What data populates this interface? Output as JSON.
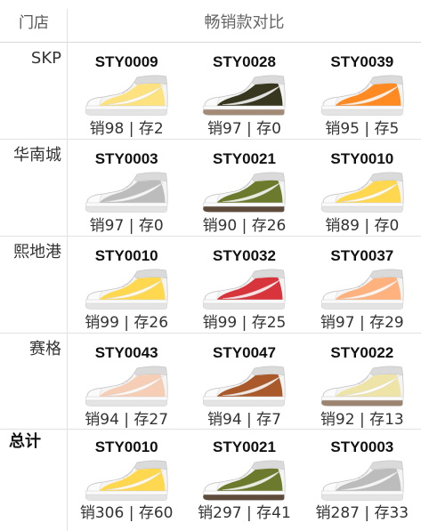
{
  "header": {
    "store_label": "门店",
    "comparison_label": "畅销款对比"
  },
  "rows": [
    {
      "store": "SKP",
      "items": [
        {
          "code": "STY0009",
          "stat": "销98 | 存2",
          "color": "#fde27f",
          "sole": "#e4e4e4"
        },
        {
          "code": "STY0028",
          "stat": "销97 | 存0",
          "color": "#37361f",
          "sole": "#a48b78"
        },
        {
          "code": "STY0039",
          "stat": "销95 | 存5",
          "color": "#ff8a22",
          "sole": "#e4e4e4"
        }
      ]
    },
    {
      "store": "华南城",
      "items": [
        {
          "code": "STY0003",
          "stat": "销97 | 存0",
          "color": "#bcbcbc",
          "sole": "#e4e4e4"
        },
        {
          "code": "STY0021",
          "stat": "销90 | 存26",
          "color": "#6b7a2c",
          "sole": "#5e4b3c"
        },
        {
          "code": "STY0010",
          "stat": "销89 | 存0",
          "color": "#ffd84f",
          "sole": "#e4e4e4"
        }
      ]
    },
    {
      "store": "熙地港",
      "items": [
        {
          "code": "STY0010",
          "stat": "销99 | 存26",
          "color": "#ffd84f",
          "sole": "#e4e4e4"
        },
        {
          "code": "STY0032",
          "stat": "销99 | 存25",
          "color": "#d7343c",
          "sole": "#e4e4e4"
        },
        {
          "code": "STY0037",
          "stat": "销97 | 存29",
          "color": "#ffb27e",
          "sole": "#e4e4e4"
        }
      ]
    },
    {
      "store": "赛格",
      "items": [
        {
          "code": "STY0043",
          "stat": "销94 | 存27",
          "color": "#f6ceb5",
          "sole": "#e4e4e4"
        },
        {
          "code": "STY0047",
          "stat": "销94 | 存7",
          "color": "#a9592a",
          "sole": "#e4e4e4"
        },
        {
          "code": "STY0022",
          "stat": "销92 | 存13",
          "color": "#efe4a8",
          "sole": "#9d8471"
        }
      ]
    },
    {
      "store": "总计",
      "items": [
        {
          "code": "STY0010",
          "stat": "销306 | 存60",
          "color": "#ffd84f",
          "sole": "#e4e4e4"
        },
        {
          "code": "STY0021",
          "stat": "销297 | 存41",
          "color": "#6b7a2c",
          "sole": "#5e4b3c"
        },
        {
          "code": "STY0003",
          "stat": "销287 | 存33",
          "color": "#bcbcbc",
          "sole": "#e4e4e4"
        }
      ]
    }
  ]
}
